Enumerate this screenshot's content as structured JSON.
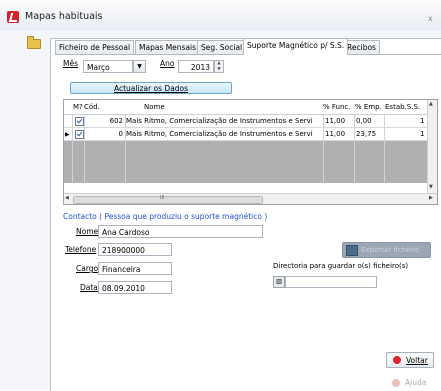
{
  "window": {
    "title": "Mapas habituais",
    "close_glyph": "x"
  },
  "tabs": [
    {
      "label": "Ficheiro de Pessoal"
    },
    {
      "label": "Mapas Mensais"
    },
    {
      "label": "Seg. Social"
    },
    {
      "label": "Suporte Magnético p/ S.S."
    },
    {
      "label": "Recibos"
    }
  ],
  "active_tab": 3,
  "filters": {
    "mes_label": "Mês",
    "mes_value": "Março",
    "ano_label": "Ano",
    "ano_value": "2013"
  },
  "update_button": "Actualizar os Dados",
  "grid": {
    "columns": [
      "M?",
      "Cód.",
      "Nome",
      "% Func.",
      "% Emp.",
      "Estab.S.S."
    ],
    "rows": [
      {
        "checked": true,
        "cod": "602",
        "nome": "Mais Ritmo, Comercialização de Instrumentos e Servi",
        "func": "11,00",
        "emp": "0,00",
        "estab": "1"
      },
      {
        "checked": true,
        "cod": "0",
        "nome": "Mais Ritmo, Comercialização de Instrumentos e Servi",
        "func": "11,00",
        "emp": "23,75",
        "estab": "1"
      }
    ],
    "hscroll_marker": "III"
  },
  "contact": {
    "title": "Contacto ( Pessoa que produziu o suporte magnético )",
    "nome_label": "Nome",
    "nome_value": "Ana Cardoso",
    "telefone_label": "Telefone",
    "telefone_value": "218900000",
    "cargo_label": "Cargo",
    "cargo_value": "Financeira",
    "data_label": "Data",
    "data_value": "08.09.2010"
  },
  "export_button": "Exportar ficheiro",
  "directory_label": "Directoria para guardar o(s) ficheiro(s)",
  "buttons": {
    "voltar": "Voltar",
    "ajuda": "Ajuda"
  }
}
